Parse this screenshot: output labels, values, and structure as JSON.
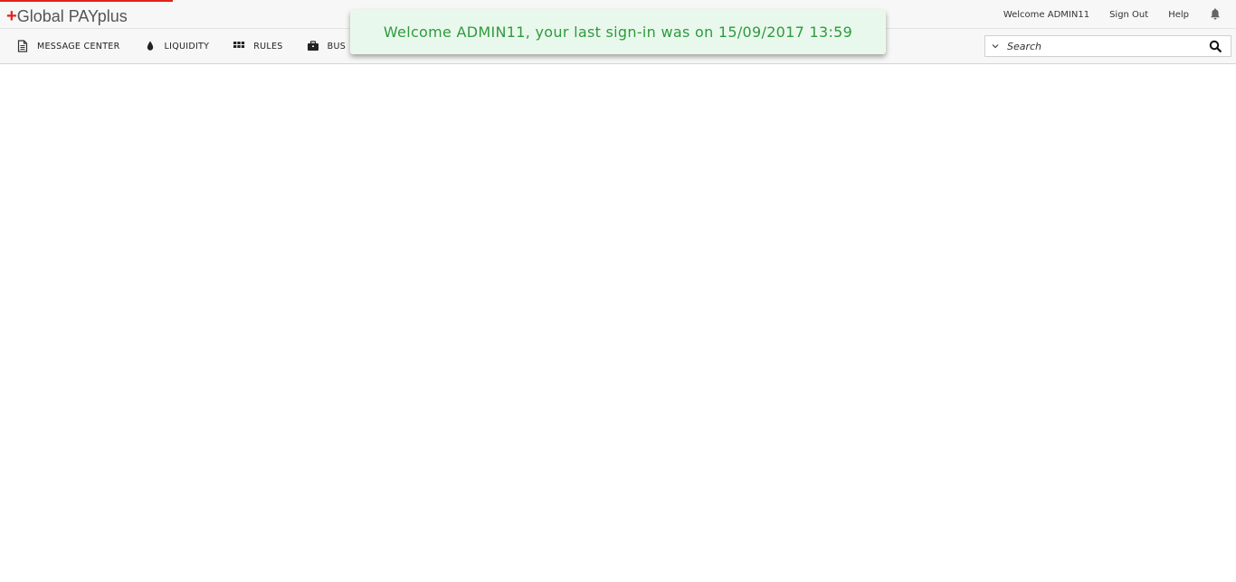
{
  "app": {
    "logo_plus": "+",
    "logo_text": "Global PAYplus"
  },
  "header": {
    "welcome": "Welcome ADMIN11",
    "sign_out": "Sign Out",
    "help": "Help",
    "bell_icon": "bell-icon"
  },
  "nav": {
    "items": [
      {
        "label": "MESSAGE CENTER",
        "icon": "document-icon"
      },
      {
        "label": "LIQUIDITY",
        "icon": "drop-icon"
      },
      {
        "label": "RULES",
        "icon": "grid-icon"
      },
      {
        "label": "BUS",
        "icon": "briefcase-icon"
      }
    ]
  },
  "search": {
    "placeholder": "Search",
    "value": ""
  },
  "toast": {
    "message": "Welcome ADMIN11, your last sign-in was on 15/09/2017 13:59"
  },
  "colors": {
    "brand_red": "#e2231a",
    "toast_text": "#2e9a3e",
    "toast_bg": "#e9f8ec"
  },
  "progress": {
    "fraction": 0.14
  }
}
